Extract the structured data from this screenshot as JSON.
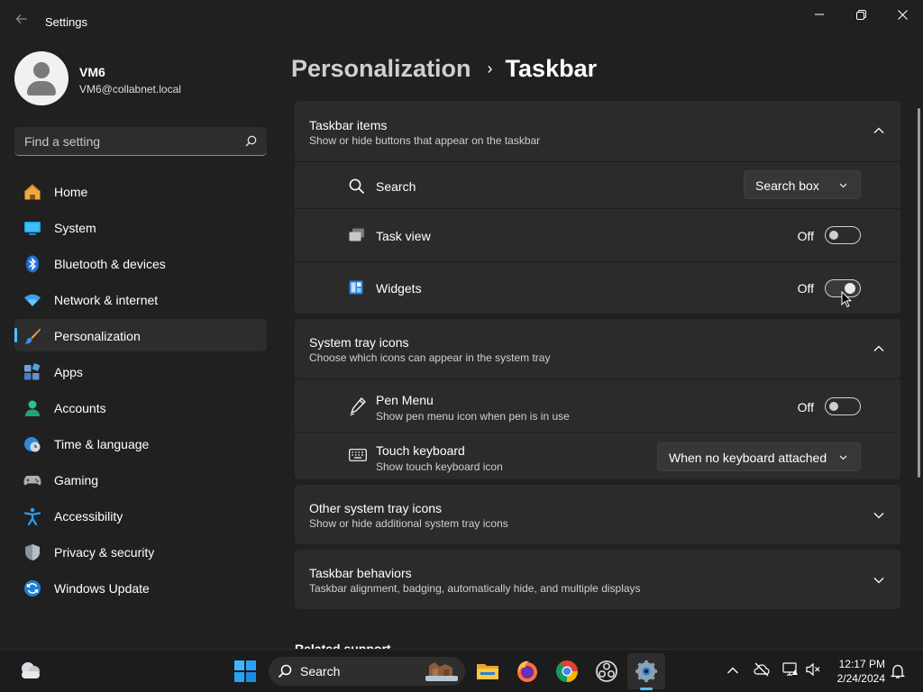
{
  "window": {
    "title": "Settings"
  },
  "user": {
    "name": "VM6",
    "email": "VM6@collabnet.local"
  },
  "search": {
    "placeholder": "Find a setting"
  },
  "sidebar": {
    "items": [
      {
        "label": "Home",
        "icon": "home-icon"
      },
      {
        "label": "System",
        "icon": "system-icon"
      },
      {
        "label": "Bluetooth & devices",
        "icon": "bluetooth-icon"
      },
      {
        "label": "Network & internet",
        "icon": "wifi-icon"
      },
      {
        "label": "Personalization",
        "icon": "brush-icon",
        "selected": true
      },
      {
        "label": "Apps",
        "icon": "apps-icon"
      },
      {
        "label": "Accounts",
        "icon": "accounts-icon"
      },
      {
        "label": "Time & language",
        "icon": "clock-globe-icon"
      },
      {
        "label": "Gaming",
        "icon": "gamepad-icon"
      },
      {
        "label": "Accessibility",
        "icon": "accessibility-icon"
      },
      {
        "label": "Privacy & security",
        "icon": "shield-icon"
      },
      {
        "label": "Windows Update",
        "icon": "update-icon"
      }
    ]
  },
  "breadcrumb": {
    "parent": "Personalization",
    "separator": "›",
    "current": "Taskbar"
  },
  "sections": {
    "taskbar_items": {
      "title": "Taskbar items",
      "description": "Show or hide buttons that appear on the taskbar",
      "rows": {
        "search": {
          "label": "Search",
          "value": "Search box"
        },
        "task_view": {
          "label": "Task view",
          "state": "Off"
        },
        "widgets": {
          "label": "Widgets",
          "state": "Off"
        }
      }
    },
    "system_tray_icons": {
      "title": "System tray icons",
      "description": "Choose which icons can appear in the system tray",
      "rows": {
        "pen_menu": {
          "label": "Pen Menu",
          "description": "Show pen menu icon when pen is in use",
          "state": "Off"
        },
        "touch_keyboard": {
          "label": "Touch keyboard",
          "description": "Show touch keyboard icon",
          "value": "When no keyboard attached"
        }
      }
    },
    "other_tray_icons": {
      "title": "Other system tray icons",
      "description": "Show or hide additional system tray icons"
    },
    "taskbar_behaviors": {
      "title": "Taskbar behaviors",
      "description": "Taskbar alignment, badging, automatically hide, and multiple displays"
    }
  },
  "related": {
    "title": "Related support"
  },
  "taskbar": {
    "search_label": "Search",
    "time": "12:17 PM",
    "date": "2/24/2024"
  },
  "colors": {
    "accent": "#4cc2ff",
    "background": "#202020",
    "card": "#2b2b2b"
  }
}
